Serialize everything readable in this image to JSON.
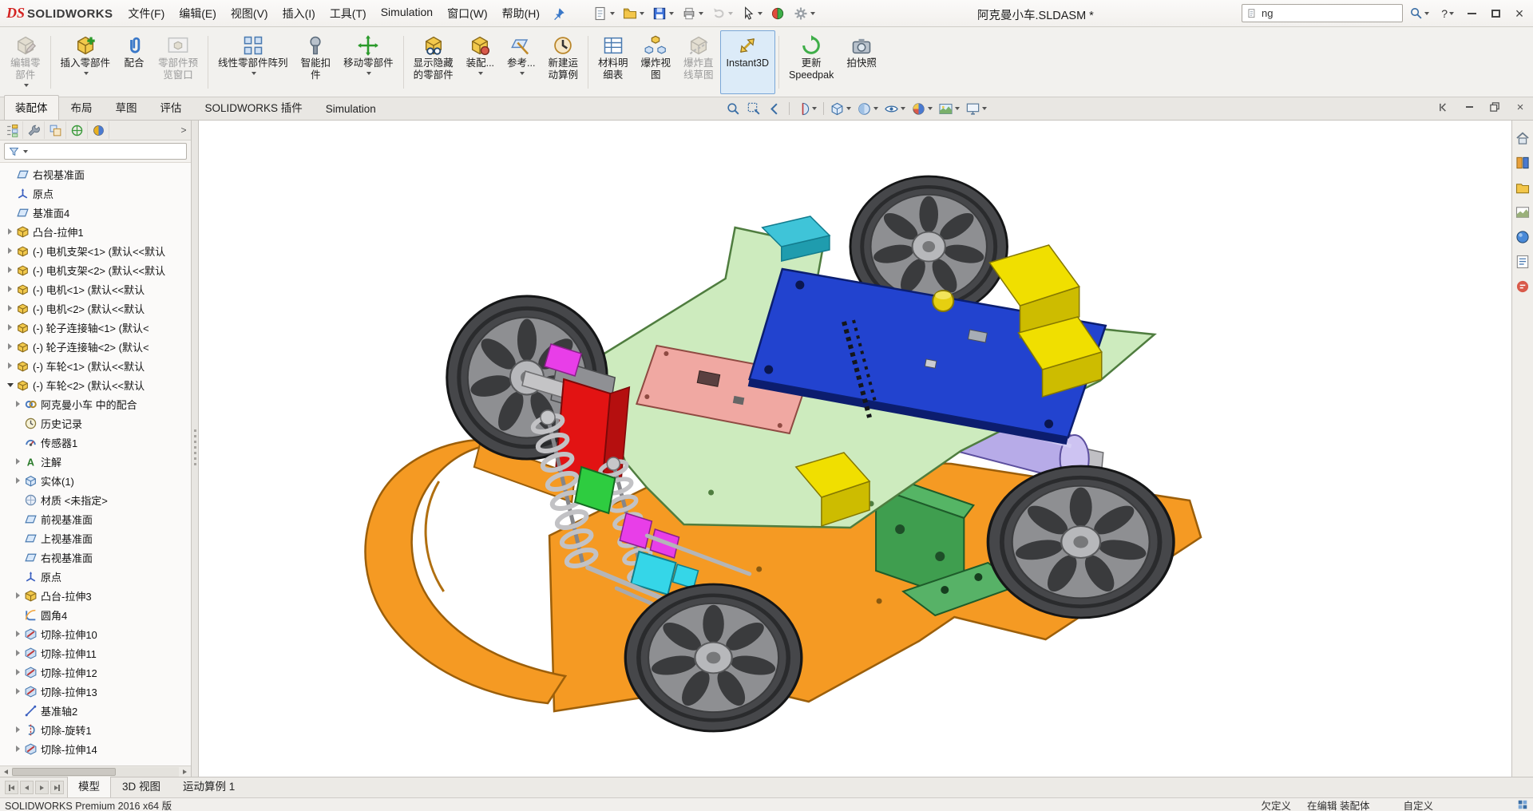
{
  "window": {
    "logo_ds": "DS",
    "logo_brand": "SOLIDWORKS",
    "title": "阿克曼小车.SLDASM *",
    "help_label": "?"
  },
  "menu": [
    "文件(F)",
    "编辑(E)",
    "视图(V)",
    "插入(I)",
    "工具(T)",
    "Simulation",
    "窗口(W)",
    "帮助(H)"
  ],
  "quickbar": [
    {
      "name": "new-document",
      "caret": true
    },
    {
      "name": "open",
      "caret": true
    },
    {
      "name": "save",
      "caret": true
    },
    {
      "name": "print",
      "caret": true
    },
    {
      "name": "undo",
      "caret": true,
      "disabled": true
    },
    {
      "name": "select",
      "caret": true
    },
    {
      "name": "rebuild",
      "caret": false
    },
    {
      "name": "options",
      "caret": true
    }
  ],
  "search": {
    "value": "ng"
  },
  "ribbon": {
    "buttons": [
      {
        "id": "edit-component",
        "lines": [
          "编辑零",
          "部件"
        ],
        "disabled": true,
        "caret": true
      },
      {
        "sep": true
      },
      {
        "id": "insert-components",
        "lines": [
          "插入零部件"
        ],
        "caret": true
      },
      {
        "id": "mate",
        "lines": [
          "配合"
        ]
      },
      {
        "id": "component-preview",
        "lines": [
          "零部件预",
          "览窗口"
        ],
        "disabled": true
      },
      {
        "sep": true
      },
      {
        "id": "linear-component-pattern",
        "lines": [
          "线性零部件阵列"
        ],
        "caret": true
      },
      {
        "id": "smart-fasteners",
        "lines": [
          "智能扣",
          "件"
        ]
      },
      {
        "id": "move-component",
        "lines": [
          "移动零部件"
        ],
        "caret": true
      },
      {
        "sep": true
      },
      {
        "id": "show-hidden-components",
        "lines": [
          "显示隐藏",
          "的零部件"
        ]
      },
      {
        "id": "assembly-features",
        "lines": [
          "装配..."
        ],
        "caret": true
      },
      {
        "id": "reference-geometry",
        "lines": [
          "参考..."
        ],
        "caret": true
      },
      {
        "id": "new-motion-study",
        "lines": [
          "新建运",
          "动算例"
        ]
      },
      {
        "sep": true
      },
      {
        "id": "bill-of-materials",
        "lines": [
          "材料明",
          "细表"
        ]
      },
      {
        "id": "exploded-view",
        "lines": [
          "爆炸视",
          "图"
        ]
      },
      {
        "id": "explode-line-sketch",
        "lines": [
          "爆炸直",
          "线草图"
        ],
        "disabled": true
      },
      {
        "id": "instant3d",
        "lines": [
          "Instant3D"
        ],
        "active": true
      },
      {
        "sep": true
      },
      {
        "id": "update-speedpak",
        "lines": [
          "更新",
          "Speedpak"
        ]
      },
      {
        "id": "take-snapshot",
        "lines": [
          "拍快照"
        ]
      }
    ]
  },
  "command_tabs": {
    "tabs": [
      {
        "label": "装配体",
        "active": true
      },
      {
        "label": "布局"
      },
      {
        "label": "草图"
      },
      {
        "label": "评估"
      },
      {
        "label": "SOLIDWORKS 插件"
      },
      {
        "label": "Simulation"
      }
    ]
  },
  "headsup": [
    {
      "name": "zoom-to-fit"
    },
    {
      "name": "zoom-to-area"
    },
    {
      "name": "previous-view"
    },
    {
      "sep": true
    },
    {
      "name": "section-view",
      "caret": true
    },
    {
      "sep": true
    },
    {
      "name": "view-orientation",
      "caret": true
    },
    {
      "name": "display-style",
      "caret": true
    },
    {
      "name": "hide-show-items",
      "caret": true
    },
    {
      "name": "edit-appearance",
      "caret": true
    },
    {
      "name": "apply-scene",
      "caret": true
    },
    {
      "name": "view-settings",
      "caret": true
    }
  ],
  "feature_tree": {
    "tabs": [
      "fm-features",
      "fm-properties",
      "fm-configurations",
      "fm-dimxpert",
      "fm-display"
    ],
    "items": [
      {
        "icon": "plane",
        "label": "右视基准面"
      },
      {
        "icon": "origin",
        "label": "原点"
      },
      {
        "icon": "plane",
        "label": "基准面4"
      },
      {
        "icon": "boss-extrude",
        "label": "凸台-拉伸1",
        "arrow": "r"
      },
      {
        "icon": "component",
        "label": "(-) 电机支架<1> (默认<<默认",
        "arrow": "r"
      },
      {
        "icon": "component",
        "label": "(-) 电机支架<2> (默认<<默认",
        "arrow": "r"
      },
      {
        "icon": "component",
        "label": "(-) 电机<1> (默认<<默认",
        "arrow": "r"
      },
      {
        "icon": "component",
        "label": "(-) 电机<2> (默认<<默认",
        "arrow": "r"
      },
      {
        "icon": "component",
        "label": "(-) 轮子连接轴<1> (默认<",
        "arrow": "r"
      },
      {
        "icon": "component",
        "label": "(-) 轮子连接轴<2> (默认<",
        "arrow": "r"
      },
      {
        "icon": "component",
        "label": "(-) 车轮<1> (默认<<默认",
        "arrow": "r"
      },
      {
        "icon": "component",
        "label": "(-) 车轮<2> (默认<<默认",
        "arrow": "d"
      },
      {
        "icon": "mates",
        "label": "阿克曼小车 中的配合",
        "arrow": "r",
        "indent": 1
      },
      {
        "icon": "history",
        "label": "历史记录",
        "indent": 1
      },
      {
        "icon": "sensors",
        "label": "传感器1",
        "indent": 1
      },
      {
        "icon": "annotations",
        "label": "注解",
        "arrow": "r",
        "indent": 1
      },
      {
        "icon": "solid-bodies",
        "label": "实体(1)",
        "arrow": "r",
        "indent": 1
      },
      {
        "icon": "material",
        "label": "材质 <未指定>",
        "indent": 1
      },
      {
        "icon": "plane",
        "label": "前视基准面",
        "indent": 1
      },
      {
        "icon": "plane",
        "label": "上视基准面",
        "indent": 1
      },
      {
        "icon": "plane",
        "label": "右视基准面",
        "indent": 1
      },
      {
        "icon": "origin",
        "label": "原点",
        "indent": 1
      },
      {
        "icon": "boss-extrude",
        "label": "凸台-拉伸3",
        "arrow": "r",
        "indent": 1
      },
      {
        "icon": "fillet",
        "label": "圆角4",
        "indent": 1
      },
      {
        "icon": "cut-extrude",
        "label": "切除-拉伸10",
        "arrow": "r",
        "indent": 1
      },
      {
        "icon": "cut-extrude",
        "label": "切除-拉伸11",
        "arrow": "r",
        "indent": 1
      },
      {
        "icon": "cut-extrude",
        "label": "切除-拉伸12",
        "arrow": "r",
        "indent": 1
      },
      {
        "icon": "cut-extrude",
        "label": "切除-拉伸13",
        "arrow": "r",
        "indent": 1
      },
      {
        "icon": "axis",
        "label": "基准轴2",
        "indent": 1
      },
      {
        "icon": "cut-revolve",
        "label": "切除-旋转1",
        "arrow": "r",
        "indent": 1
      },
      {
        "icon": "cut-extrude",
        "label": "切除-拉伸14",
        "arrow": "r",
        "indent": 1
      }
    ]
  },
  "task_pane": [
    "solidworks-resources",
    "design-library",
    "file-explorer",
    "view-palette",
    "appearances-scenes",
    "custom-properties",
    "forum"
  ],
  "bottom_tabs": {
    "tabs": [
      {
        "label": "模型",
        "active": true
      },
      {
        "label": "3D 视图"
      },
      {
        "label": "运动算例 1"
      }
    ]
  },
  "status_bar": {
    "left": "SOLIDWORKS Premium 2016 x64 版",
    "items": [
      "欠定义",
      "在编辑 装配体",
      "自定义"
    ]
  },
  "model_colors": {
    "chassis": "#f59a23",
    "chassis_edge": "#9c5f0a",
    "deck": "#cdebbe",
    "deck_edge": "#4f7d3f",
    "pcb": "#2243cf",
    "pcb_edge": "#0b1e70",
    "pink_board": "#f0a8a2",
    "yellow": "#f0df00",
    "yellow_dark": "#cdbc00",
    "teal": "#3fc4d8",
    "motor": "#b7abe8",
    "bracket_green": "#3f9e4f",
    "red_part": "#e21313",
    "magenta": "#e83ee8",
    "cyan": "#35d6e8",
    "spring": "#c2c2c5",
    "wheel_tire": "#46474a",
    "wheel_rim": "#8e8f92"
  }
}
